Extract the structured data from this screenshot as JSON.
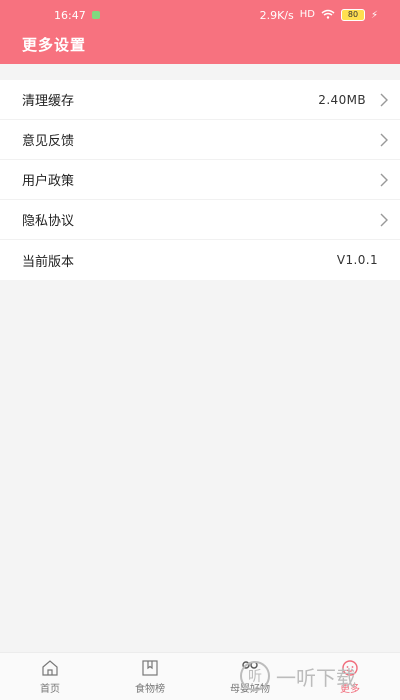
{
  "status": {
    "time": "16:47",
    "speed": "2.9K/s",
    "signal": "HD",
    "battery": "80"
  },
  "header": {
    "title": "更多设置"
  },
  "settings": [
    {
      "label": "清理缓存",
      "value": "2.40MB",
      "chevron": true
    },
    {
      "label": "意见反馈",
      "value": "",
      "chevron": true
    },
    {
      "label": "用户政策",
      "value": "",
      "chevron": true
    },
    {
      "label": "隐私协议",
      "value": "",
      "chevron": true
    },
    {
      "label": "当前版本",
      "value": "V1.0.1",
      "chevron": false
    }
  ],
  "tabs": [
    {
      "label": "首页",
      "icon": "home-icon",
      "active": false
    },
    {
      "label": "食物榜",
      "icon": "bookmark-icon",
      "active": false
    },
    {
      "label": "母婴好物",
      "icon": "stroller-icon",
      "active": false
    },
    {
      "label": "更多",
      "icon": "more-face-icon",
      "active": true
    }
  ],
  "watermark": {
    "text": "一听下载",
    "icon_text": "听"
  },
  "colors": {
    "header": "#f7727f",
    "active_tab": "#f06b7a",
    "background": "#f4f4f4"
  }
}
